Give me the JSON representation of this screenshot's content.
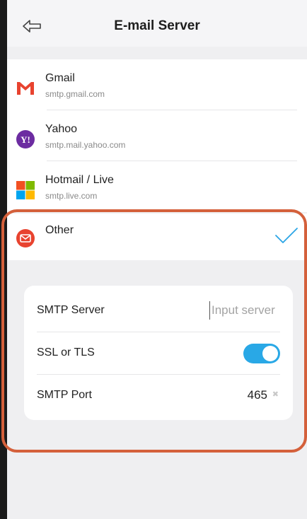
{
  "header": {
    "title": "E-mail Server",
    "back_icon": "back-arrow-icon"
  },
  "providers": [
    {
      "name": "Gmail",
      "server": "smtp.gmail.com",
      "icon": "gmail-icon",
      "color": "#e8432f"
    },
    {
      "name": "Yahoo",
      "server": "smtp.mail.yahoo.com",
      "icon": "yahoo-icon",
      "color": "#6c2ca1"
    },
    {
      "name": "Hotmail / Live",
      "server": "smtp.live.com",
      "icon": "windows-icon",
      "color": "#f25022"
    }
  ],
  "other": {
    "name": "Other",
    "selected": true,
    "icon": "envelope-icon",
    "color": "#e8432f",
    "check_color": "#2aa5e6"
  },
  "settings": {
    "smtp_server_label": "SMTP Server",
    "smtp_server_placeholder": "Input server",
    "smtp_server_value": "",
    "ssl_label": "SSL or TLS",
    "ssl_enabled": true,
    "port_label": "SMTP Port",
    "port_value": "465"
  },
  "colors": {
    "accent": "#29a8e6",
    "highlight": "#d4603b"
  }
}
